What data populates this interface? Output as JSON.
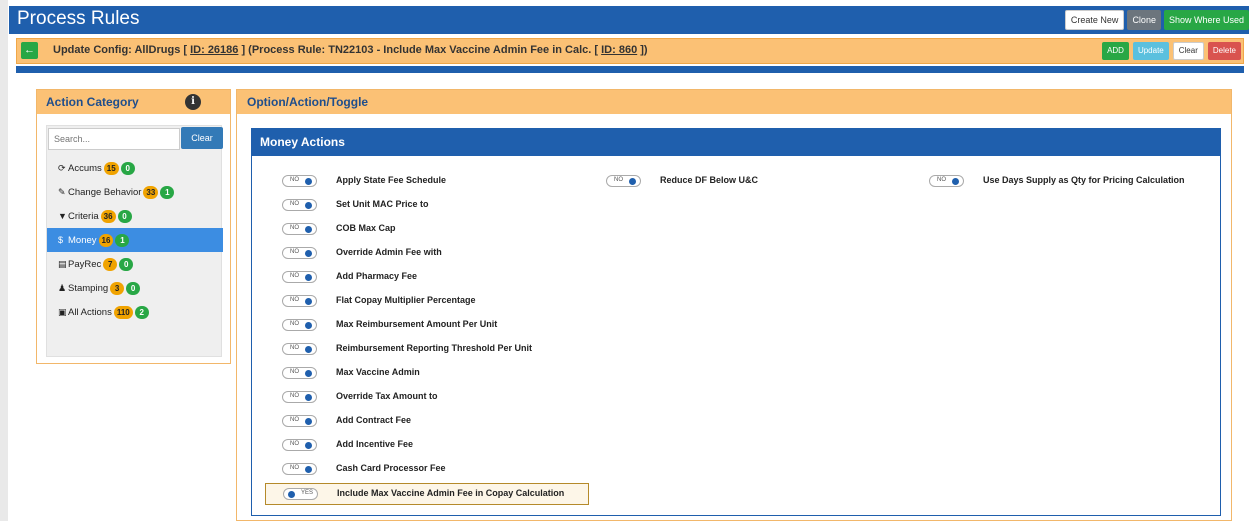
{
  "header": {
    "title": "Process Rules",
    "buttons": {
      "create_new": "Create New",
      "clone": "Clone",
      "show_where_used": "Show Where Used"
    }
  },
  "config": {
    "back_icon": "arrow-left-icon",
    "title_prefix": "Update Config: AllDrugs [ ",
    "config_id": "ID: 26186",
    "title_middle": " ] (Process Rule: TN22103 - Include Max Vaccine Admin Fee in Calc. [ ",
    "rule_id": "ID: 860",
    "title_suffix": " ])",
    "buttons": {
      "add": "ADD",
      "update": "Update",
      "clear": "Clear",
      "delete": "Delete"
    }
  },
  "action_category": {
    "title": "Action Category",
    "info_icon": "info-icon",
    "search": {
      "placeholder": "Search...",
      "value": "",
      "clear_label": "Clear"
    },
    "items": [
      {
        "icon": "refresh-icon",
        "glyph": "⟳",
        "label": "Accums",
        "count": "15",
        "active_count": "0",
        "selected": false
      },
      {
        "icon": "wrench-icon",
        "glyph": "✎",
        "label": "Change Behavior",
        "count": "33",
        "active_count": "1",
        "selected": false
      },
      {
        "icon": "filter-icon",
        "glyph": "▼",
        "label": "Criteria",
        "count": "36",
        "active_count": "0",
        "selected": false
      },
      {
        "icon": "dollar-icon",
        "glyph": "$",
        "label": "Money",
        "count": "16",
        "active_count": "1",
        "selected": true
      },
      {
        "icon": "receipt-icon",
        "glyph": "▤",
        "label": "PayRec",
        "count": "7",
        "active_count": "0",
        "selected": false
      },
      {
        "icon": "stamp-icon",
        "glyph": "♟",
        "label": "Stamping",
        "count": "3",
        "active_count": "0",
        "selected": false
      },
      {
        "icon": "clipboard-icon",
        "glyph": "▣",
        "label": "All Actions",
        "count": "110",
        "active_count": "2",
        "selected": false
      }
    ]
  },
  "options": {
    "title": "Option/Action/Toggle",
    "section_title": "Money Actions",
    "toggle_no": "NO",
    "toggle_yes": "YES",
    "actions": [
      {
        "label": "Apply State Fee Schedule",
        "state": "NO"
      },
      {
        "label": "Reduce DF Below U&C",
        "state": "NO"
      },
      {
        "label": "Use Days Supply as Qty for Pricing Calculation",
        "state": "NO"
      },
      {
        "label": "Set Unit MAC Price to",
        "state": "NO"
      },
      {
        "label": "COB Max Cap",
        "state": "NO"
      },
      {
        "label": "Override Admin Fee with",
        "state": "NO"
      },
      {
        "label": "Add Pharmacy Fee",
        "state": "NO"
      },
      {
        "label": "Flat Copay Multiplier Percentage",
        "state": "NO"
      },
      {
        "label": "Max Reimbursement Amount Per Unit",
        "state": "NO"
      },
      {
        "label": "Reimbursement Reporting Threshold Per Unit",
        "state": "NO"
      },
      {
        "label": "Max Vaccine Admin",
        "state": "NO"
      },
      {
        "label": "Override Tax Amount to",
        "state": "NO"
      },
      {
        "label": "Add Contract Fee",
        "state": "NO"
      },
      {
        "label": "Add Incentive Fee",
        "state": "NO"
      },
      {
        "label": "Cash Card Processor Fee",
        "state": "NO"
      },
      {
        "label": "Include Max Vaccine Admin Fee in Copay Calculation",
        "state": "YES"
      }
    ]
  }
}
